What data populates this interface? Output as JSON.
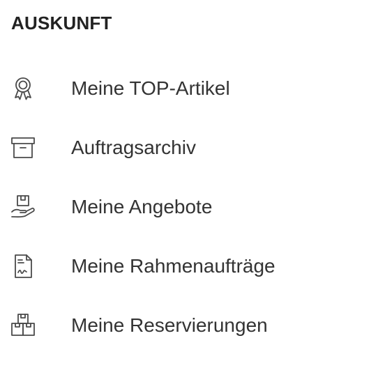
{
  "section": {
    "title": "AUSKUNFT",
    "items": [
      {
        "label": "Meine TOP-Artikel",
        "icon": "award-ribbon-icon"
      },
      {
        "label": "Auftragsarchiv",
        "icon": "archive-box-icon"
      },
      {
        "label": "Meine Angebote",
        "icon": "hand-package-icon"
      },
      {
        "label": "Meine Rahmenaufträge",
        "icon": "contract-document-icon"
      },
      {
        "label": "Meine Reservierungen",
        "icon": "stacked-boxes-icon"
      }
    ]
  },
  "colors": {
    "text": "#333333",
    "heading": "#222222",
    "icon_stroke": "#4a4a4a",
    "background": "#ffffff"
  }
}
